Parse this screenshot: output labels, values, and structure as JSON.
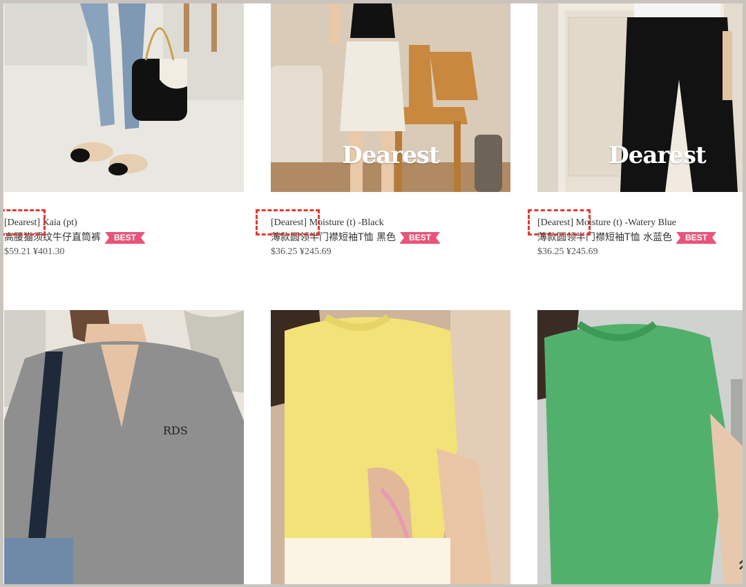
{
  "products": [
    {
      "title": "[Dearest] Kaia (pt)",
      "subtitle": "高腰猫须纹牛仔直筒裤",
      "badge": "BEST",
      "price": "$59.21 ¥401.30",
      "watermark": ""
    },
    {
      "title": "[Dearest] Moisture (t) -Black",
      "subtitle": "薄款圆领半门襟短袖T恤 黑色",
      "badge": "BEST",
      "price": "$36.25 ¥245.69",
      "watermark": "Dearest"
    },
    {
      "title": "[Dearest] Moisture (t) -Watery Blue",
      "subtitle": "薄款圆领半门襟短袖T恤 水蓝色",
      "badge": "BEST",
      "price": "$36.25 ¥245.69",
      "watermark": "Dearest"
    }
  ],
  "row2_images": [
    "gray-henley-knit-photo",
    "yellow-cable-knit-cardigan-photo",
    "green-cable-knit-cardigan-photo"
  ],
  "colors": {
    "badge": "#e8547a",
    "highlight_dash": "#e03a2f"
  },
  "icons": {
    "scroll_top": "chevron-up-icon"
  }
}
